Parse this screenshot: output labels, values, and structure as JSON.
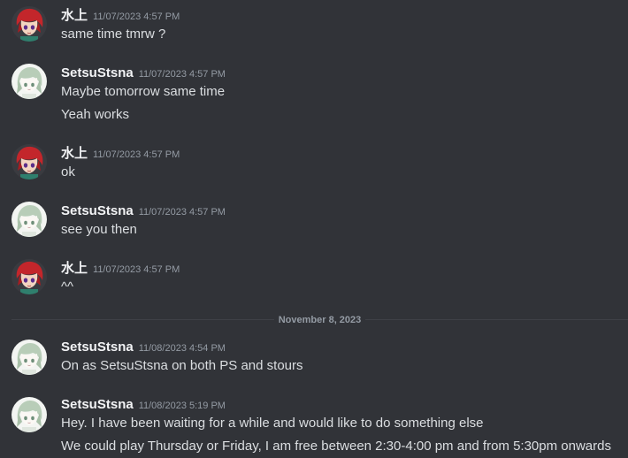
{
  "users": {
    "mizukami": "水上",
    "setsu": "SetsuStsna"
  },
  "messages": [
    {
      "author": "水上",
      "timestamp": "11/07/2023 4:57 PM",
      "lines": [
        "same time tmrw ?"
      ]
    },
    {
      "author": "SetsuStsna",
      "timestamp": "11/07/2023 4:57 PM",
      "lines": [
        "Maybe tomorrow same time",
        "Yeah works"
      ]
    },
    {
      "author": "水上",
      "timestamp": "11/07/2023 4:57 PM",
      "lines": [
        "ok"
      ]
    },
    {
      "author": "SetsuStsna",
      "timestamp": "11/07/2023 4:57 PM",
      "lines": [
        "see you then"
      ]
    },
    {
      "author": "水上",
      "timestamp": "11/07/2023 4:57 PM",
      "lines": [
        "^^"
      ]
    },
    {
      "author": "SetsuStsna",
      "timestamp": "11/08/2023 4:54 PM",
      "lines": [
        "On as SetsuStsna on both PS and stours"
      ]
    },
    {
      "author": "SetsuStsna",
      "timestamp": "11/08/2023 5:19 PM",
      "lines": [
        "Hey. I have been waiting for a while and would like to do something else",
        "We could play Thursday or Friday, I am free between 2:30-4:00 pm and from 5:30pm onwards"
      ]
    }
  ],
  "date_divider": "November 8, 2023",
  "colors": {
    "background": "#313338",
    "author": "#f2f3f5",
    "text": "#dbdee1",
    "muted": "#949ba4"
  }
}
